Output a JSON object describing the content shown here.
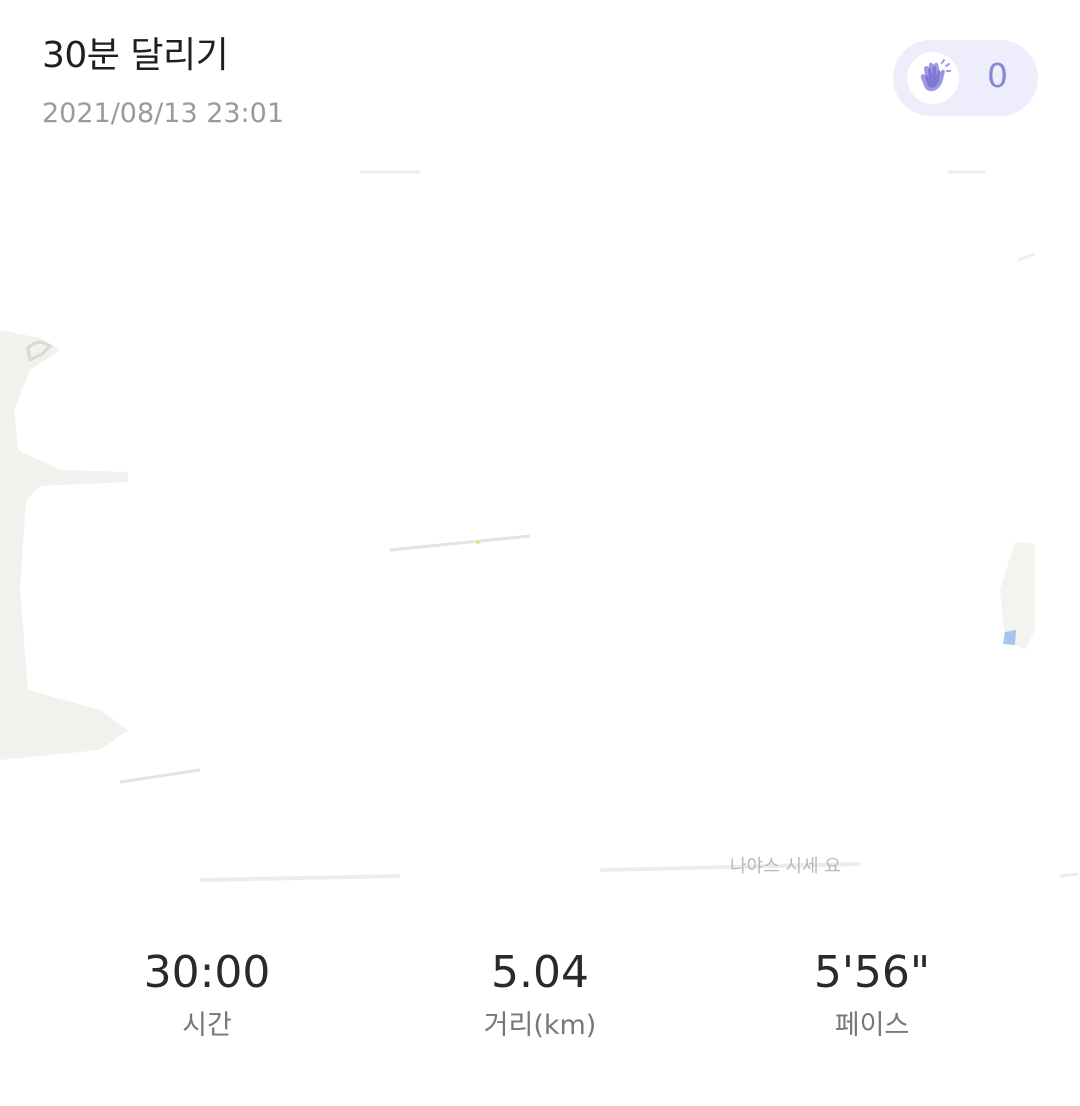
{
  "header": {
    "title": "30분 달리기",
    "date": "2021/08/13 23:01",
    "clap_count": "0"
  },
  "map": {
    "label_fragment": "나야스 시세 요"
  },
  "stats": {
    "time": {
      "value": "30:00",
      "label": "시간"
    },
    "distance": {
      "value": "5.04",
      "label": "거리(km)"
    },
    "pace": {
      "value": "5'56\"",
      "label": "페이스"
    }
  },
  "icons": {
    "clap": "clap-hands-icon"
  },
  "colors": {
    "accent": "#8a85d6",
    "pill_bg": "#ededfb",
    "map_land": "#f1f1ee",
    "map_water": "#aac4f0"
  }
}
